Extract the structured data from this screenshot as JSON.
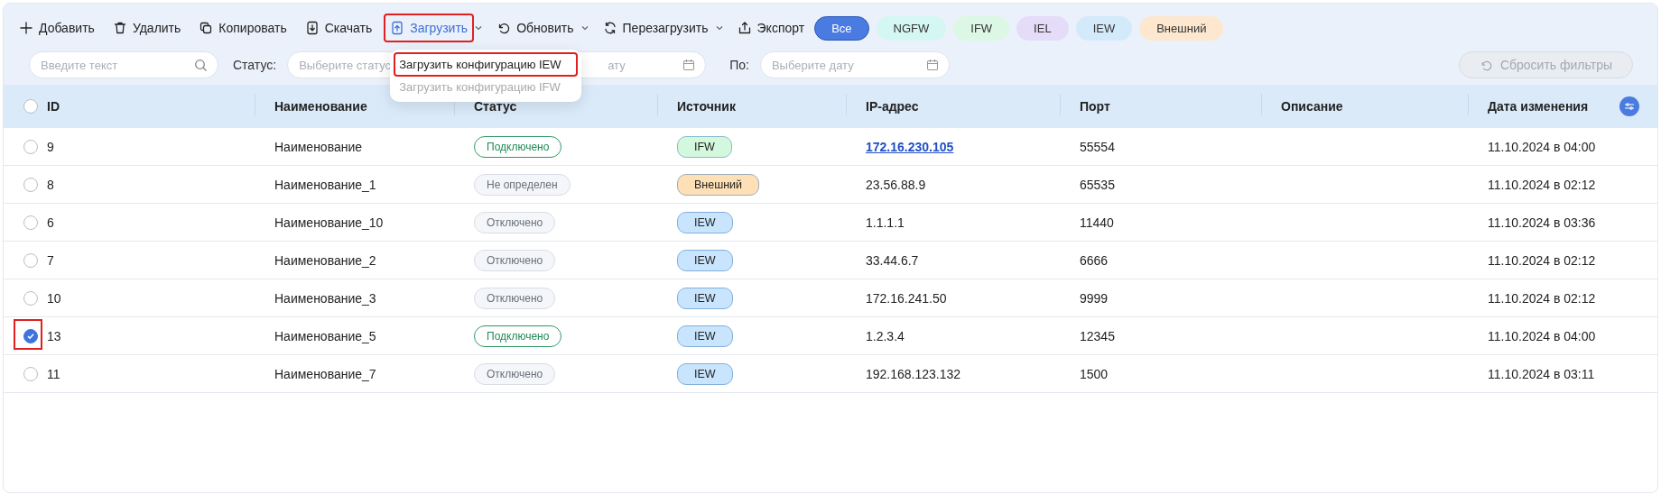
{
  "toolbar": [
    {
      "label": "Добавить",
      "highlighted": false
    },
    {
      "label": "Удалить",
      "highlighted": false
    },
    {
      "label": "Копировать",
      "highlighted": false
    },
    {
      "label": "Скачать",
      "highlighted": false
    },
    {
      "label": "Загрузить",
      "dropdown": true,
      "open": true,
      "highlighted": true
    },
    {
      "label": "Обновить",
      "dropdown": true,
      "open": false,
      "highlighted": false
    },
    {
      "label": "Перезагрузить",
      "dropdown": true,
      "open": false,
      "highlighted": false
    },
    {
      "label": "Экспорт",
      "highlighted": false
    }
  ],
  "upload_menu": [
    {
      "label": "Загрузить конфигурацию IEW",
      "disabled": false,
      "highlighted": true
    },
    {
      "label": "Загрузить конфигурацию IFW",
      "disabled": true,
      "highlighted": false
    }
  ],
  "source_chips": [
    {
      "label": "Все",
      "selected": true,
      "color": "#4a7be0"
    },
    {
      "label": "NGFW",
      "selected": false,
      "color": "#d5f7f3"
    },
    {
      "label": "IFW",
      "selected": false,
      "color": "#dcf8e4"
    },
    {
      "label": "IEL",
      "selected": false,
      "color": "#e4dcf8"
    },
    {
      "label": "IEW",
      "selected": false,
      "color": "#d3eafb"
    },
    {
      "label": "Внешний",
      "selected": false,
      "color": "#fde7cf"
    }
  ],
  "filters": {
    "search": {
      "placeholder": "Введите текст"
    },
    "status": {
      "label": "Статус:",
      "placeholder": "Выберите статус"
    },
    "date_from": {
      "placeholder": "ату"
    },
    "date_to": {
      "label": "По:",
      "placeholder": "Выберите дату"
    },
    "reset": {
      "label": "Сбросить фильтры",
      "disabled": true
    }
  },
  "table": {
    "header_checked": false,
    "columns": [
      "ID",
      "Наименование",
      "Статус",
      "Источник",
      "IP-адрес",
      "Порт",
      "Описание",
      "Дата изменения"
    ],
    "rows": [
      {
        "selected": false,
        "highlighted": false,
        "id": "9",
        "name": "Наименование",
        "status": {
          "label": "Подключено",
          "kind": "connected"
        },
        "source": {
          "label": "IFW",
          "color": "#d3f8dd"
        },
        "ip": "172.16.230.105",
        "ip_link": true,
        "port": "55554",
        "date": "11.10.2024 в 04:00"
      },
      {
        "selected": false,
        "highlighted": false,
        "id": "8",
        "name": "Наименование_1",
        "status": {
          "label": "Не определен",
          "kind": "unknown"
        },
        "source": {
          "label": "Внешний",
          "color": "#fde0b5"
        },
        "ip": "23.56.88.9",
        "ip_link": false,
        "port": "65535",
        "date": "11.10.2024 в 02:12"
      },
      {
        "selected": false,
        "highlighted": false,
        "id": "6",
        "name": "Наименование_10",
        "status": {
          "label": "Отключено",
          "kind": "disconnected"
        },
        "source": {
          "label": "IEW",
          "color": "#c8e5fd"
        },
        "ip": "1.1.1.1",
        "ip_link": false,
        "port": "11440",
        "date": "11.10.2024 в 03:36"
      },
      {
        "selected": false,
        "highlighted": false,
        "id": "7",
        "name": "Наименование_2",
        "status": {
          "label": "Отключено",
          "kind": "disconnected"
        },
        "source": {
          "label": "IEW",
          "color": "#c8e5fd"
        },
        "ip": "33.44.6.7",
        "ip_link": false,
        "port": "6666",
        "date": "11.10.2024 в 02:12"
      },
      {
        "selected": false,
        "highlighted": false,
        "id": "10",
        "name": "Наименование_3",
        "status": {
          "label": "Отключено",
          "kind": "disconnected"
        },
        "source": {
          "label": "IEW",
          "color": "#c8e5fd"
        },
        "ip": "172.16.241.50",
        "ip_link": false,
        "port": "9999",
        "date": "11.10.2024 в 02:12"
      },
      {
        "selected": true,
        "highlighted": true,
        "id": "13",
        "name": "Наименование_5",
        "status": {
          "label": "Подключено",
          "kind": "connected"
        },
        "source": {
          "label": "IEW",
          "color": "#c8e5fd"
        },
        "ip": "1.2.3.4",
        "ip_link": false,
        "port": "12345",
        "date": "11.10.2024 в 04:00"
      },
      {
        "selected": false,
        "highlighted": false,
        "id": "11",
        "name": "Наименование_7",
        "status": {
          "label": "Отключено",
          "kind": "disconnected"
        },
        "source": {
          "label": "IEW",
          "color": "#c8e5fd"
        },
        "ip": "192.168.123.132",
        "ip_link": false,
        "port": "1500",
        "date": "11.10.2024 в 03:11"
      }
    ]
  }
}
